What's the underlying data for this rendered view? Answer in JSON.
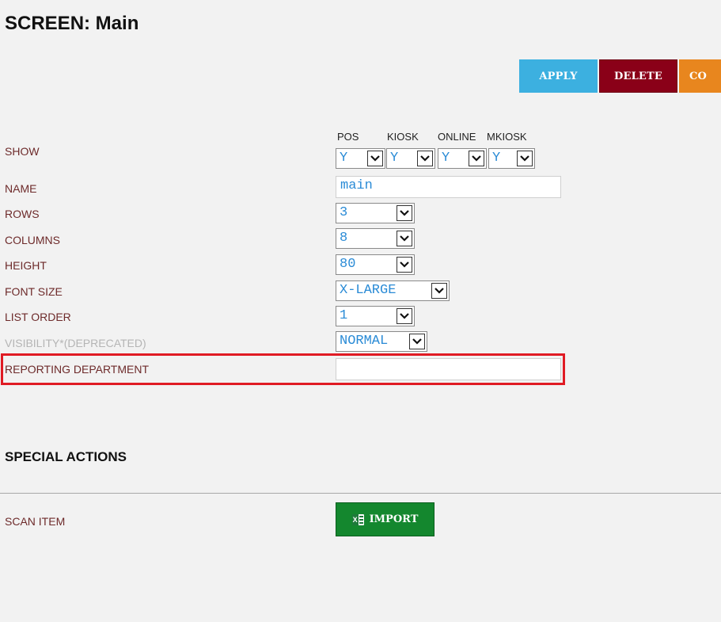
{
  "page": {
    "title": "SCREEN: Main"
  },
  "toolbar": {
    "apply_label": "APPLY",
    "delete_label": "DELETE",
    "copy_label": "CO",
    "colors": {
      "apply": "#3cb0e0",
      "delete": "#8a0018",
      "copy": "#e8861e"
    }
  },
  "show_columns": [
    "POS",
    "KIOSK",
    "ONLINE",
    "MKIOSK"
  ],
  "form": {
    "show": {
      "label": "SHOW",
      "values": [
        "Y",
        "Y",
        "Y",
        "Y"
      ]
    },
    "name": {
      "label": "NAME",
      "value": "main"
    },
    "rows": {
      "label": "ROWS",
      "value": "3"
    },
    "columns": {
      "label": "COLUMNS",
      "value": "8"
    },
    "height": {
      "label": "HEIGHT",
      "value": "80"
    },
    "font_size": {
      "label": "FONT SIZE",
      "value": "X-LARGE"
    },
    "list_order": {
      "label": "LIST ORDER",
      "value": "1"
    },
    "visibility": {
      "label": "VISIBILITY*(DEPRECATED)",
      "value": "NORMAL"
    },
    "reporting_department": {
      "label": "REPORTING DEPARTMENT",
      "value": ""
    }
  },
  "special_actions": {
    "title": "SPECIAL ACTIONS",
    "scan_item_label": "SCAN ITEM",
    "import_label": "IMPORT",
    "import_icon": "excel-icon",
    "import_color": "#14872e"
  },
  "highlight_color": "#e01b24"
}
